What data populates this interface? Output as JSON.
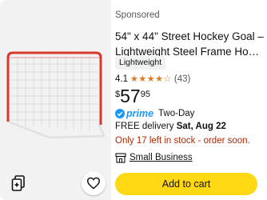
{
  "product": {
    "sponsored_label": "Sponsored",
    "title_line1": "54\" x 44\" Street Hockey Goal –",
    "title_line2": "Lightweight Steel Frame Hock...",
    "badge": "Lightweight",
    "rating": {
      "value": "4.1",
      "stars_out_of_5": 4.1,
      "count": "(43)"
    },
    "price": {
      "currency": "$",
      "whole": "57",
      "fraction": "95"
    },
    "prime": {
      "logo": "prime",
      "type": "Two-Day"
    },
    "delivery": {
      "label": "FREE delivery",
      "date": "Sat, Aug 22"
    },
    "stock_text": "Only 17 left in stock - order soon.",
    "small_business_label": "Small Business",
    "add_to_cart_label": "Add to cart"
  },
  "icons": {
    "compare": "compare-icon",
    "wishlist": "heart-icon",
    "prime_check": "prime-check-icon",
    "small_business": "small-business-icon"
  },
  "colors": {
    "star": "#de7921",
    "prime": "#1a98ff",
    "stock_warning": "#b12704",
    "add_to_cart": "#ffd814",
    "image_background": "#f2f2f2"
  }
}
